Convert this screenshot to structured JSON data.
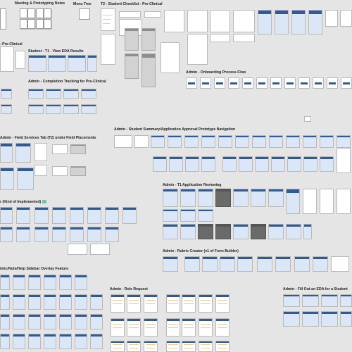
{
  "sections": {
    "meeting_notes": "Meeting & Prototyping Notes",
    "menu_tree": "Menu Tree",
    "t2_checklist": "T2 - Student Checklist - Pre-Clinical",
    "pre_clinical": "- Pre-Clinical",
    "t1_eda": "Student - T1 - View EDA Results",
    "onboarding": "Admin - Onboarding Process Flow",
    "completion": "Admin - Completion Tracking for Pre-Clinical",
    "summary_nav": "Admin - Student Summary/Application Approval Prototype Navigation",
    "field_services": "Admin - Field Services Tab (T2) under Field Placements",
    "t1_review": "Admin - T1 Application Reviewing",
    "kind_impl": "r (Kind of Implemented)",
    "rubric": "Admin - Rubric Creator (v1 of Form Builder)",
    "sidebar_overlay": "imic/Note/Help Sidebar Overlay Feature",
    "role_request": "Admin - Role Request",
    "fill_eda": "Admin - Fill Out an EDA for a Student"
  },
  "colors": {
    "canvas": "#e5e5e5",
    "frame_header": "#2f5a96",
    "frame_band": "#c9daf2",
    "accent_green": "#74c69d",
    "form_dots": "#e6a23c"
  }
}
